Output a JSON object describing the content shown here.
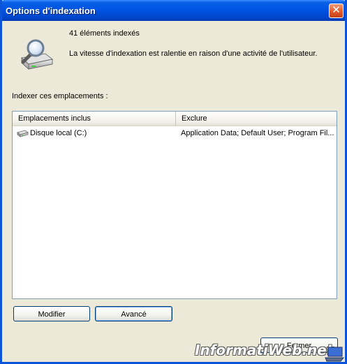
{
  "window": {
    "title": "Options d'indexation",
    "close_label": "✕"
  },
  "summary": {
    "count_text": "41 éléments indexés",
    "status_text": "La vitesse d'indexation est ralentie en raison d'une activité de l'utilisateur."
  },
  "locations": {
    "label": "Indexer ces emplacements :",
    "columns": {
      "included": "Emplacements inclus",
      "exclude": "Exclure"
    },
    "rows": [
      {
        "location": "Disque local (C:)",
        "exclusions": "Application Data; Default User; Program Fil..."
      }
    ]
  },
  "buttons": {
    "modifier": "Modifier",
    "avance": "Avancé",
    "fermer": "Fermer"
  },
  "watermark": {
    "text": "InformatiWeb.net"
  },
  "icons": {
    "summary": "magnifier-drive-icon",
    "drive": "hard-drive-icon",
    "close": "close-icon",
    "watermark_logo": "laptop-logo-icon"
  },
  "colors": {
    "titlebar": "#0054e3",
    "window_bg": "#ece9d8",
    "close_button": "#e35b2a"
  }
}
